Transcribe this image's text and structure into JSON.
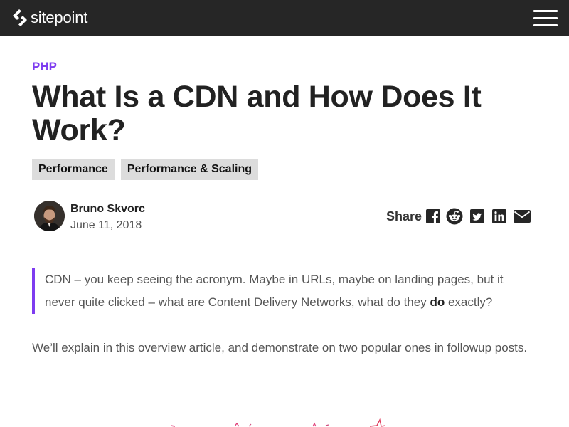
{
  "header": {
    "brand": "sitepoint",
    "logo_icon": "sitepoint-logo-icon",
    "menu_icon": "hamburger-menu-icon",
    "background": "#262626"
  },
  "article": {
    "category": "PHP",
    "title": "What Is a CDN and How Does It Work?",
    "tags": [
      "Performance",
      "Performance & Scaling"
    ],
    "author": {
      "name": "Bruno Skvorc",
      "date": "June 11, 2018"
    },
    "share": {
      "label": "Share",
      "icons": [
        "facebook-icon",
        "reddit-icon",
        "twitter-icon",
        "linkedin-icon",
        "email-icon"
      ]
    },
    "lead": {
      "before": "CDN – you keep seeing the acronym. Maybe in URLs, maybe on landing pages, but it never quite clicked – what are Content Delivery Networks, what do they ",
      "bold": "do",
      "after": " exactly?"
    },
    "paragraph": "We’ll explain in this overview article, and demonstrate on two popular ones in followup posts."
  },
  "colors": {
    "accent": "#7e3cf0",
    "tag_background": "#dcdcdc",
    "text": "#222222",
    "muted_text": "#555555"
  }
}
